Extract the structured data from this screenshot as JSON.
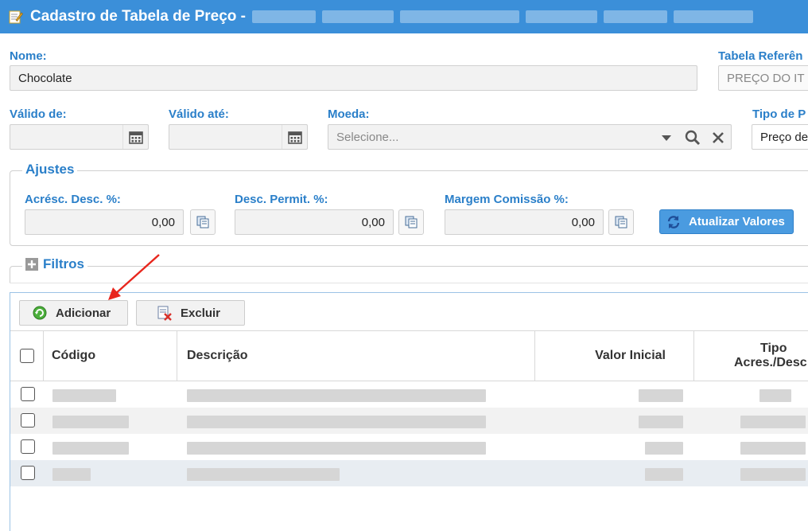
{
  "title": {
    "text": "Cadastro de Tabela de Preço -",
    "icon": "edit-icon"
  },
  "form": {
    "nome_label": "Nome:",
    "nome_value": "Chocolate",
    "tabela_ref_label": "Tabela Referên",
    "tabela_ref_value": "PREÇO DO IT",
    "valido_de_label": "Válido de:",
    "valido_ate_label": "Válido até:",
    "moeda_label": "Moeda:",
    "moeda_placeholder": "Selecione...",
    "tipo_label": "Tipo de P",
    "tipo_value": "Preço de"
  },
  "ajustes": {
    "legend": "Ajustes",
    "acresc_label": "Acrésc. Desc. %:",
    "acresc_value": "0,00",
    "desc_label": "Desc. Permit. %:",
    "desc_value": "0,00",
    "margem_label": "Margem Comissão %:",
    "margem_value": "0,00",
    "atualizar_label": "Atualizar Valores"
  },
  "filtros": {
    "legend": "Filtros"
  },
  "toolbar": {
    "adicionar": "Adicionar",
    "excluir": "Excluir"
  },
  "grid": {
    "columns": {
      "codigo": "Código",
      "descricao": "Descrição",
      "valor_inicial": "Valor Inicial",
      "tipo_line1": "Tipo",
      "tipo_line2": "Acres./Desc"
    },
    "row_count": 4
  },
  "colors": {
    "accent": "#3b8fd9",
    "label": "#2a7fc9",
    "annotation_arrow": "#e8261d"
  }
}
